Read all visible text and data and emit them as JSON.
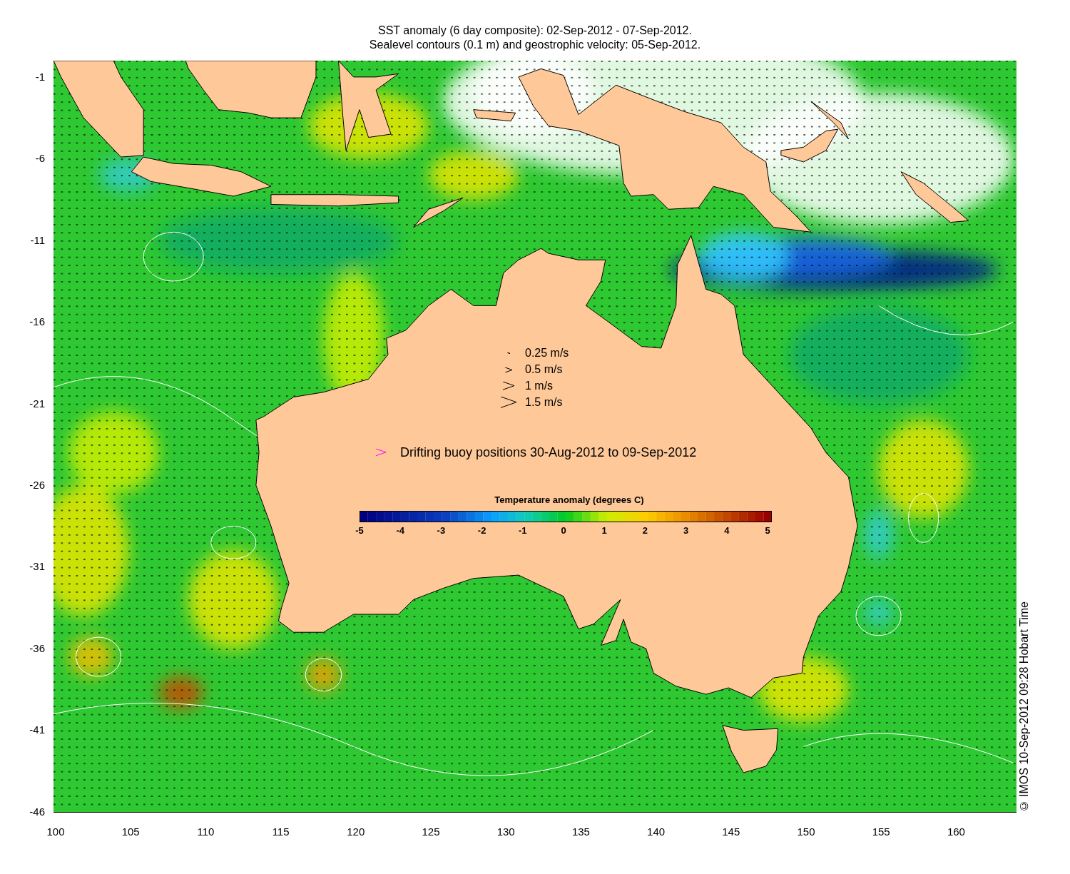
{
  "title": {
    "line_1": "SST anomaly (6 day composite): 02-Sep-2012 - 07-Sep-2012.",
    "line_2": "Sealevel contours (0.1 m) and geostrophic velocity: 05-Sep-2012."
  },
  "y_axis": {
    "ticks": [
      "-1",
      "-6",
      "-11",
      "-16",
      "-21",
      "-26",
      "-31",
      "-36",
      "-41",
      "-46"
    ]
  },
  "x_axis": {
    "ticks": [
      "100",
      "105",
      "110",
      "115",
      "120",
      "125",
      "130",
      "135",
      "140",
      "145",
      "150",
      "155",
      "160"
    ]
  },
  "velocity_legend": [
    {
      "label": "0.25 m/s"
    },
    {
      "label": "0.5 m/s"
    },
    {
      "label": "1 m/s"
    },
    {
      "label": "1.5 m/s"
    }
  ],
  "buoy_legend": {
    "label": "Drifting buoy positions 30-Aug-2012 to 09-Sep-2012"
  },
  "colorbar": {
    "title": "Temperature anomaly (degrees C)",
    "ticks": [
      "-5",
      "-4",
      "-3",
      "-2",
      "-1",
      "0",
      "1",
      "2",
      "3",
      "4",
      "5"
    ]
  },
  "credit": "© IMOS 10-Sep-2012 09:28 Hobart Time"
}
